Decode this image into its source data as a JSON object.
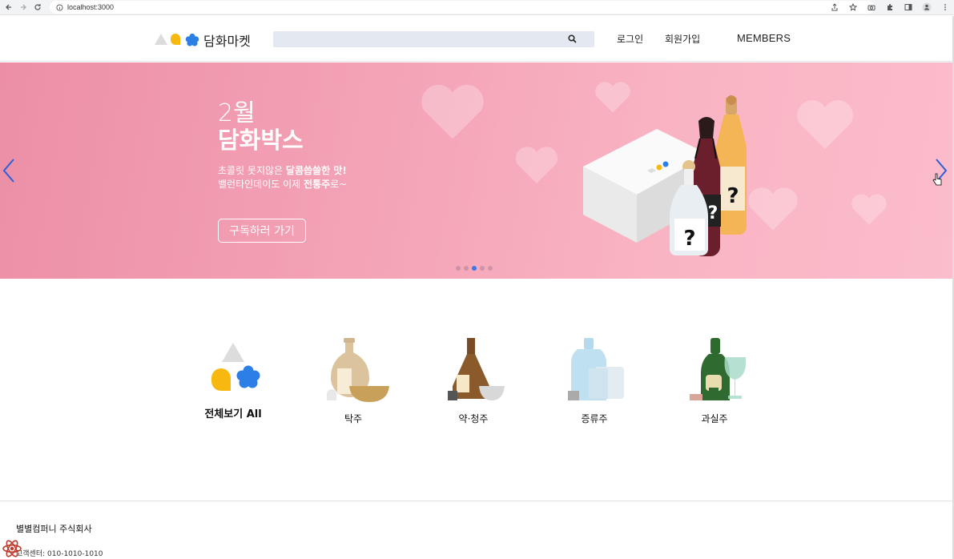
{
  "browser": {
    "url": "localhost:3000"
  },
  "header": {
    "logo_text": "담화마켓",
    "search_placeholder": "",
    "login": "로그인",
    "signup": "회원가입",
    "members": "MEMBERS"
  },
  "banner": {
    "month": "2월",
    "title": "담화박스",
    "desc_line1_a": "초콜릿 못지않은 ",
    "desc_line1_b": "달콤씁쓸한 맛!",
    "desc_line2_a": "밸런타인데이도 이제 ",
    "desc_line2_b": "전통주",
    "desc_line2_c": "로~",
    "cta": "구독하러 가기",
    "bottle_mark": "?",
    "active_slide": 3,
    "slide_count": 5
  },
  "categories": [
    {
      "label": "전체보기 All",
      "icon": "shapes-icon"
    },
    {
      "label": "탁주",
      "icon": "makgeolli-icon"
    },
    {
      "label": "약·청주",
      "icon": "yakju-icon"
    },
    {
      "label": "증류주",
      "icon": "soju-icon"
    },
    {
      "label": "과실주",
      "icon": "wine-icon"
    }
  ],
  "footer": {
    "company": "별별컴퍼니 주식회사",
    "customer_center": "고객센터: 010-1010-1010"
  },
  "colors": {
    "banner_pink": "#f4a3b6",
    "dot_active": "#3c78e6",
    "search_bg": "#e4e9f1"
  }
}
